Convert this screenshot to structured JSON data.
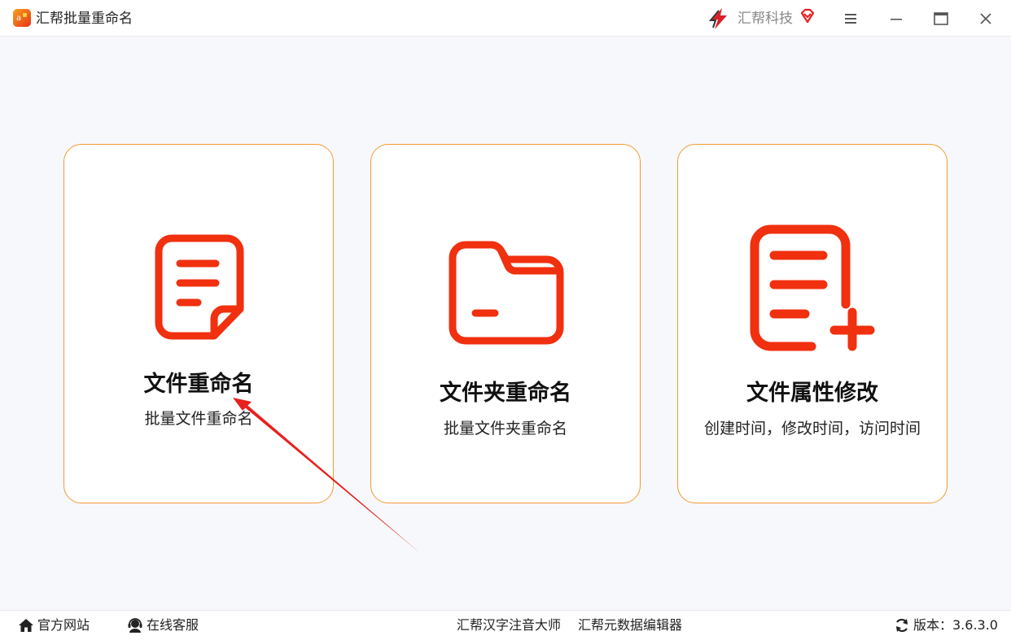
{
  "app": {
    "title": "汇帮批量重命名",
    "brand": "汇帮科技"
  },
  "colors": {
    "accent": "#f39a33",
    "icon_red": "#f0300f",
    "arrow_red": "#e8201e"
  },
  "icons": {
    "app": "app-logo-icon",
    "brand": "brand-logo-icon",
    "vip": "diamond-vip-icon",
    "menu": "hamburger-menu-icon",
    "minimize": "minimize-icon",
    "maximize": "maximize-icon",
    "close": "close-icon"
  },
  "cards": [
    {
      "title": "文件重命名",
      "subtitle": "批量文件重命名",
      "icon": "document-icon"
    },
    {
      "title": "文件夹重命名",
      "subtitle": "批量文件夹重命名",
      "icon": "folder-icon"
    },
    {
      "title": "文件属性修改",
      "subtitle": "创建时间，修改时间，访问时间",
      "icon": "document-add-icon"
    }
  ],
  "footer": {
    "website": "官方网站",
    "service": "在线客服",
    "pinyin_tool": "汇帮汉字注音大师",
    "metadata_tool": "汇帮元数据编辑器",
    "version": "版本：3.6.3.0"
  }
}
